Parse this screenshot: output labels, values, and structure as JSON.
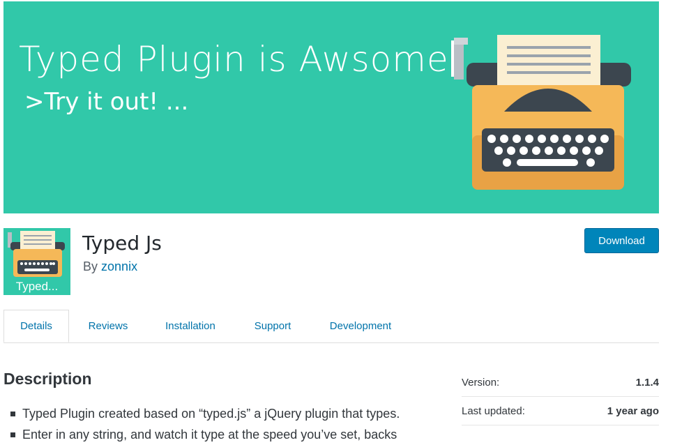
{
  "banner": {
    "headline": "Typed Plugin is Awsome",
    "tagline": ">Try it out! ..."
  },
  "plugin": {
    "icon_label": "Typed...",
    "name": "Typed Js",
    "author_prefix": "By",
    "author_name": "zonnix",
    "download_label": "Download"
  },
  "tabs": [
    {
      "label": "Details",
      "active": true
    },
    {
      "label": "Reviews",
      "active": false
    },
    {
      "label": "Installation",
      "active": false
    },
    {
      "label": "Support",
      "active": false
    },
    {
      "label": "Development",
      "active": false
    }
  ],
  "description": {
    "heading": "Description",
    "items": [
      "Typed Plugin created based on “typed.js” a jQuery plugin that types.",
      "Enter in any string, and watch it type at the speed you’ve set, backs"
    ]
  },
  "meta": [
    {
      "label": "Version:",
      "value": "1.1.4"
    },
    {
      "label": "Last updated:",
      "value": "1 year ago"
    }
  ],
  "colors": {
    "banner": "#31c8a9",
    "link": "#0073aa",
    "button": "#0085ba"
  }
}
